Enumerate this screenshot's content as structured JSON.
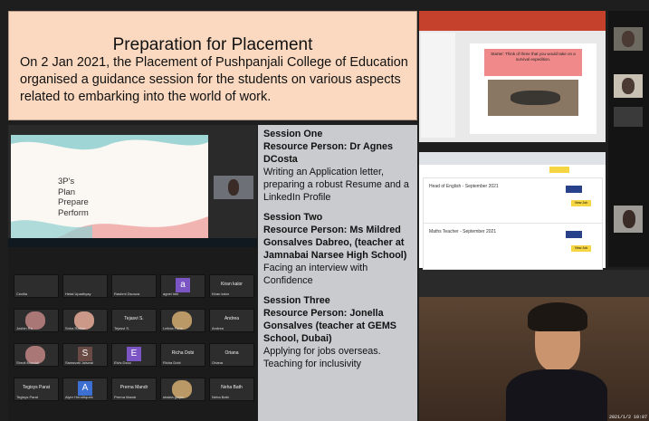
{
  "header": {
    "title": "Preparation for Placement",
    "description": "On 2 Jan 2021, the Placement of Pushpanjali College of Education organised a  guidance session for the students on various aspects related to  embarking into the world of work."
  },
  "slide": {
    "lines": [
      "3P's",
      "Plan",
      "Prepare",
      "Perform"
    ]
  },
  "sessions": [
    {
      "heading": "Session One",
      "person": "Resource Person: Dr Agnes DCosta",
      "topic": "Writing an Application letter, preparing a robust Resume and a LinkedIn Profile"
    },
    {
      "heading": "Session Two",
      "person": "Resource  Person: Ms Mildred Gonsalves Dabreo, (teacher at Jamnabai Narsee High School)",
      "topic": "Facing an interview with Confidence"
    },
    {
      "heading": "Session Three",
      "person": "Resource Person: Jonella Gonsalves (teacher at GEMS School, Dubai)",
      "topic": "Applying for jobs overseas. Teaching for inclusivity"
    }
  ],
  "participants": [
    {
      "label": "Cecilia",
      "kind": "empty"
    },
    {
      "label": "Hetal Upadhyay",
      "kind": "empty"
    },
    {
      "label": "Rashmi Dsouza",
      "kind": "empty"
    },
    {
      "label": "agnel hier",
      "kind": "letter",
      "letter": "a",
      "color": "#7b55c4"
    },
    {
      "label": "Kiran kalor",
      "kind": "name"
    },
    {
      "label": "Joshin Ra",
      "kind": "face"
    },
    {
      "label": "Snha Raikar",
      "kind": "face"
    },
    {
      "label": "Tejasvi S.",
      "kind": "name"
    },
    {
      "label": "Leticia Ferre",
      "kind": "face"
    },
    {
      "label": "Andrea",
      "kind": "name"
    },
    {
      "label": "Shruti Mondal",
      "kind": "face"
    },
    {
      "label": "Sarasvati Jaiswal",
      "kind": "letter",
      "letter": "S",
      "color": "#6a4a44"
    },
    {
      "label": "Elvis Dsou",
      "kind": "letter",
      "letter": "E",
      "color": "#7b55c4"
    },
    {
      "label": "Richa Dobi",
      "kind": "name"
    },
    {
      "label": "Oriana",
      "kind": "name"
    },
    {
      "label": "Tegisys Parat",
      "kind": "name"
    },
    {
      "label": "Alyer Hendriques",
      "kind": "letter",
      "letter": "A",
      "color": "#3c6fd1"
    },
    {
      "label": "Prerna Mandr",
      "kind": "name"
    },
    {
      "label": "shakla gurjar",
      "kind": "face"
    },
    {
      "label": "Neha Bath",
      "kind": "name"
    }
  ],
  "ppt_slide_text": "Starter: Think of three that you would take on a survival expedition.",
  "jobs": [
    {
      "title": "Head of English - September 2021",
      "button": "View Job"
    },
    {
      "title": "Maths Teacher - September 2021",
      "button": "View Job"
    }
  ],
  "timestamp": "2021/1/2  10:07"
}
